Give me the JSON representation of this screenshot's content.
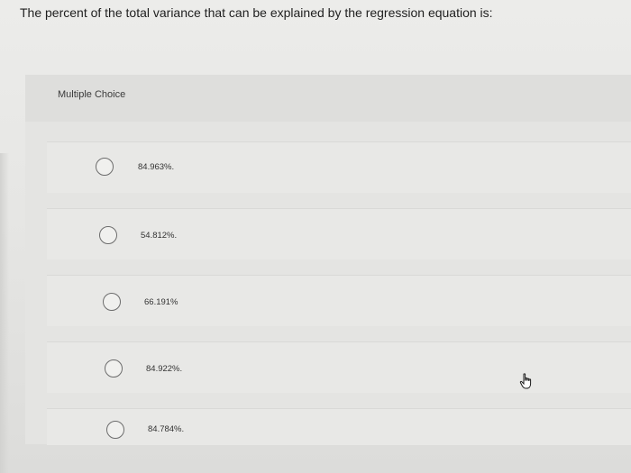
{
  "question": {
    "text": "The percent of the total variance that can be explained by the regression equation is:"
  },
  "multiple_choice": {
    "label": "Multiple Choice",
    "options": [
      {
        "label": "84.963%."
      },
      {
        "label": "54.812%."
      },
      {
        "label": "66.191%"
      },
      {
        "label": "84.922%."
      },
      {
        "label": "84.784%."
      }
    ]
  },
  "cursor": {
    "icon": "hand-pointer-icon"
  }
}
